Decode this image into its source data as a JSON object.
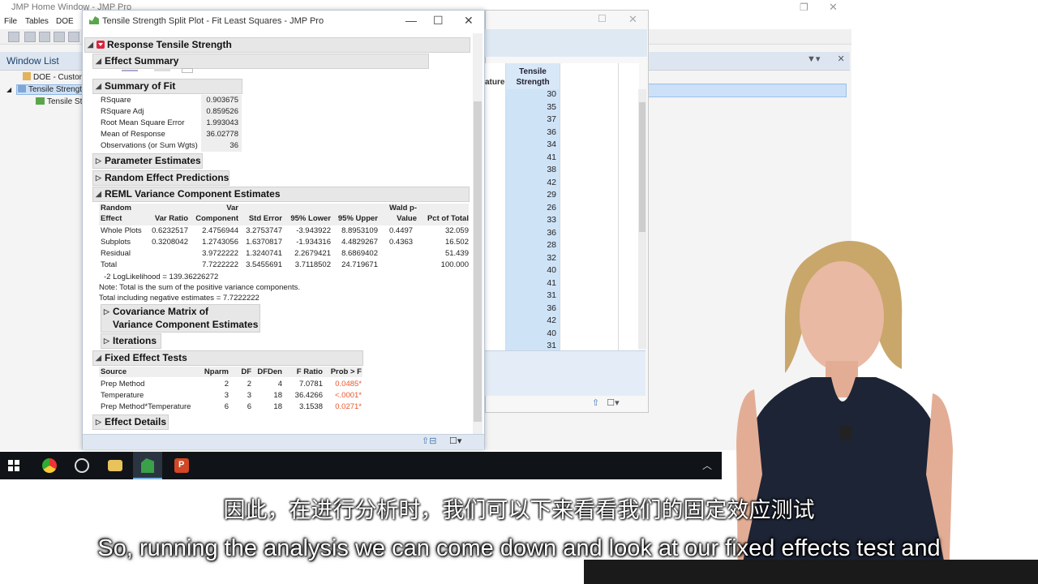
{
  "home_window": {
    "title": "JMP Home Window - JMP Pro",
    "menu": [
      "File",
      "Tables",
      "DOE"
    ],
    "window_list_label": "Window List",
    "tree_items": [
      "DOE - Custon",
      "Tensile Strengt",
      "Tensile Str"
    ]
  },
  "data_table": {
    "left_col_partial": "ature",
    "column_header": "Tensile Strength",
    "values": [
      "30",
      "35",
      "37",
      "36",
      "34",
      "41",
      "38",
      "42",
      "29",
      "26",
      "33",
      "36",
      "28",
      "32",
      "40",
      "41",
      "31",
      "36",
      "42",
      "40",
      "31"
    ]
  },
  "report": {
    "title": "Tensile Strength Split Plot - Fit Least Squares - JMP Pro",
    "response_header": "Response Tensile Strength",
    "effect_summary": "Effect Summary",
    "summary_of_fit": {
      "header": "Summary of Fit",
      "rows": [
        {
          "label": "RSquare",
          "value": "0.903675"
        },
        {
          "label": "RSquare Adj",
          "value": "0.859526"
        },
        {
          "label": "Root Mean Square Error",
          "value": "1.993043"
        },
        {
          "label": "Mean of Response",
          "value": "36.02778"
        },
        {
          "label": "Observations (or Sum Wgts)",
          "value": "36"
        }
      ]
    },
    "parameter_estimates": "Parameter Estimates",
    "random_effect_predictions": "Random Effect Predictions",
    "reml": {
      "header": "REML Variance Component Estimates",
      "columns": [
        "Random Effect",
        "Var Ratio",
        "Var Component",
        "Std Error",
        "95% Lower",
        "95% Upper",
        "Wald p-Value",
        "Pct of Total"
      ],
      "rows": [
        [
          "Whole Plots",
          "0.6232517",
          "2.4756944",
          "3.2753747",
          "-3.943922",
          "8.8953109",
          "0.4497",
          "32.059"
        ],
        [
          "Subplots",
          "0.3208042",
          "1.2743056",
          "1.6370817",
          "-1.934316",
          "4.4829267",
          "0.4363",
          "16.502"
        ],
        [
          "Residual",
          "",
          "3.9722222",
          "1.3240741",
          "2.2679421",
          "8.6869402",
          "",
          "51.439"
        ],
        [
          "Total",
          "",
          "7.7222222",
          "3.5455691",
          "3.7118502",
          "24.719671",
          "",
          "100.000"
        ]
      ],
      "loglik": "-2 LogLikelihood = 139.36226272",
      "note": "Note: Total is the sum of the positive variance components.",
      "total_neg": "Total including negative estimates = 7.7222222"
    },
    "covariance_matrix_line1": "Covariance Matrix of",
    "covariance_matrix_line2": "Variance Component Estimates",
    "iterations": "Iterations",
    "fixed_effect_tests": {
      "header": "Fixed Effect Tests",
      "columns": [
        "Source",
        "Nparm",
        "DF",
        "DFDen",
        "F Ratio",
        "Prob > F"
      ],
      "rows": [
        [
          "Prep Method",
          "2",
          "2",
          "4",
          "7.0781",
          "0.0485*"
        ],
        [
          "Temperature",
          "3",
          "3",
          "18",
          "36.4266",
          "<.0001*"
        ],
        [
          "Prep Method*Temperature",
          "6",
          "6",
          "18",
          "3.1538",
          "0.0271*"
        ]
      ]
    },
    "effect_details": "Effect Details"
  },
  "subtitles": {
    "chinese": "因此，在进行分析时，我们可以下来看看我们的固定效应测试",
    "english": "So, running the analysis we can come down and look at our fixed effects test and"
  },
  "colors": {
    "prob_text": "#e8572c",
    "report_header_bg": "#e7e7e7",
    "data_column_bg": "#cfe3f7",
    "taskbar": "#101418"
  }
}
